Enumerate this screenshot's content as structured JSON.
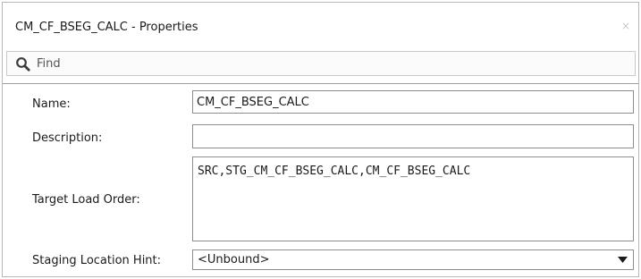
{
  "window": {
    "title": "CM_CF_BSEG_CALC - Properties",
    "close_glyph": "×"
  },
  "find": {
    "placeholder": "Find",
    "value": ""
  },
  "properties": {
    "name": {
      "label": "Name:",
      "value": "CM_CF_BSEG_CALC"
    },
    "description": {
      "label": "Description:",
      "value": ""
    },
    "target_load_order": {
      "label": "Target Load Order:",
      "value": "SRC,STG_CM_CF_BSEG_CALC,CM_CF_BSEG_CALC"
    },
    "staging_location_hint": {
      "label": "Staging Location Hint:",
      "selected": "<Unbound>"
    }
  },
  "icons": {
    "find": "magnifier-icon",
    "close": "close-icon",
    "dropdown": "caret-down-icon"
  }
}
